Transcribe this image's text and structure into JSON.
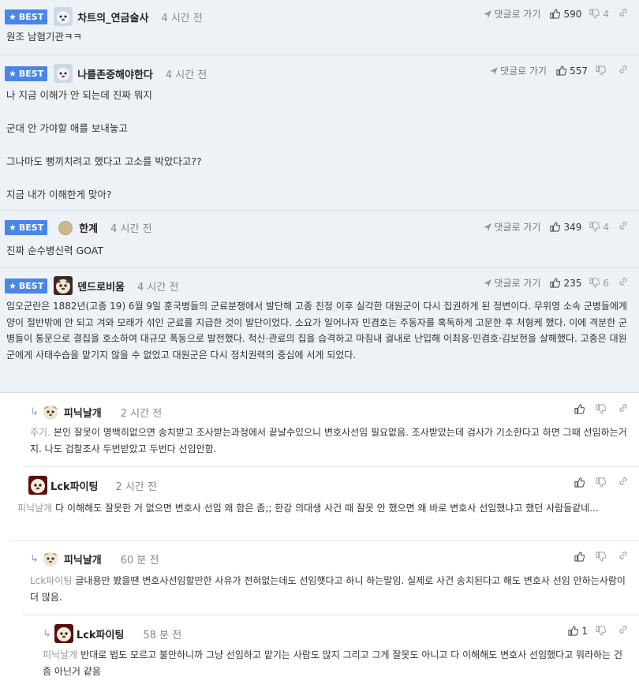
{
  "labels": {
    "best": "BEST",
    "reply_link": "댓글로 가기"
  },
  "comments": [
    {
      "nick": "차트의_연금술사",
      "time": "4 시간 전",
      "up": "590",
      "down": "4",
      "text": "원조 남혐기관ㅋㅋ"
    },
    {
      "nick": "나를존중해야한다",
      "time": "4 시간 전",
      "up": "557",
      "down": "",
      "text": "나 지금 이해가 안 되는데 진짜 뭐지\n\n군대 안 가야할 애를 보내놓고\n\n그나마도 뻥끼치려고 했다고 고소를 박았다고??\n\n지금 내가 이해한게 맞아?"
    },
    {
      "nick": "한계",
      "time": "4 시간 전",
      "up": "349",
      "down": "4",
      "text": "진짜 순수병신력 GOAT"
    },
    {
      "nick": "덴드로비움",
      "time": "4 시간 전",
      "up": "235",
      "down": "6",
      "text": "임오군란은 1882년(고종 19) 6월 9일 훈국병들의 군료분쟁에서 발단해 고종 친정 이후 실각한 대원군이 다시 집권하게 된 정변이다. 무위영 소속 군병들에게 양이 절반밖에 안 되고 겨와 모래가 섞인 군료를 지급한 것이 발단이었다. 소요가 일어나자 민겸호는 주동자를 혹독하게 고문한 후 처형케 했다. 이에 격분한 군병들이 통문으로 결집을 호소하여 대규모 폭동으로 발전했다. 척신·관료의 집을 습격하고 마침내 궐내로 난입해 이최응·민겸호·김보현을 살해했다. 고종은 대원군에게 사태수습을 맡기지 않을 수 없었고 대원군은 다시 정치권력의 중심에 서게 되었다."
    }
  ],
  "replies": [
    {
      "nick": "피닉날개",
      "time": "2 시간 전",
      "up": "",
      "ref": "주기.",
      "text": "본인 잘못이 명백히없으면 송치받고 조사받는과정에서 끝날수있으니 변호사선임 필요없음. 조사받았는데 검사가 기소한다고 하면 그때 선임하는거지. 나도 검찰조사 두번받았고 두번다 선임안함."
    },
    {
      "nick": "Lck파이팅",
      "time": "2 시간 전",
      "up": "",
      "ref": "피닉날개",
      "text": "다 이해해도 잘못한 거 없으면 변호사 선임 왜 함은 좀;; 한강 의대생 사건 때 잘못 안 했으면 왜 바로 변호사 선임했냐고 했던 사람들같네..."
    },
    {
      "nick": "피닉날개",
      "time": "60 분 전",
      "up": "",
      "ref": "Lck파이팅",
      "text": "글내용만 봤을땐 변호사선임할만한 사유가 전혀없는데도 선임햇다고 하니 하는말임. 실제로 사건 송치된다고 해도 변호사 선임 안하는사람이 더 많음."
    },
    {
      "nick": "Lck파이팅",
      "time": "58 분 전",
      "up": "1",
      "ref": "피닉날개",
      "text": "반대로 법도 모르고 불안하니까 그냥 선임하고 맡기는 사람도 많지 그리고 그게 잘못도 아니고 다 이해해도 변호사 선임했다고 뭐라하는 건 좀 아닌거 같음"
    }
  ]
}
